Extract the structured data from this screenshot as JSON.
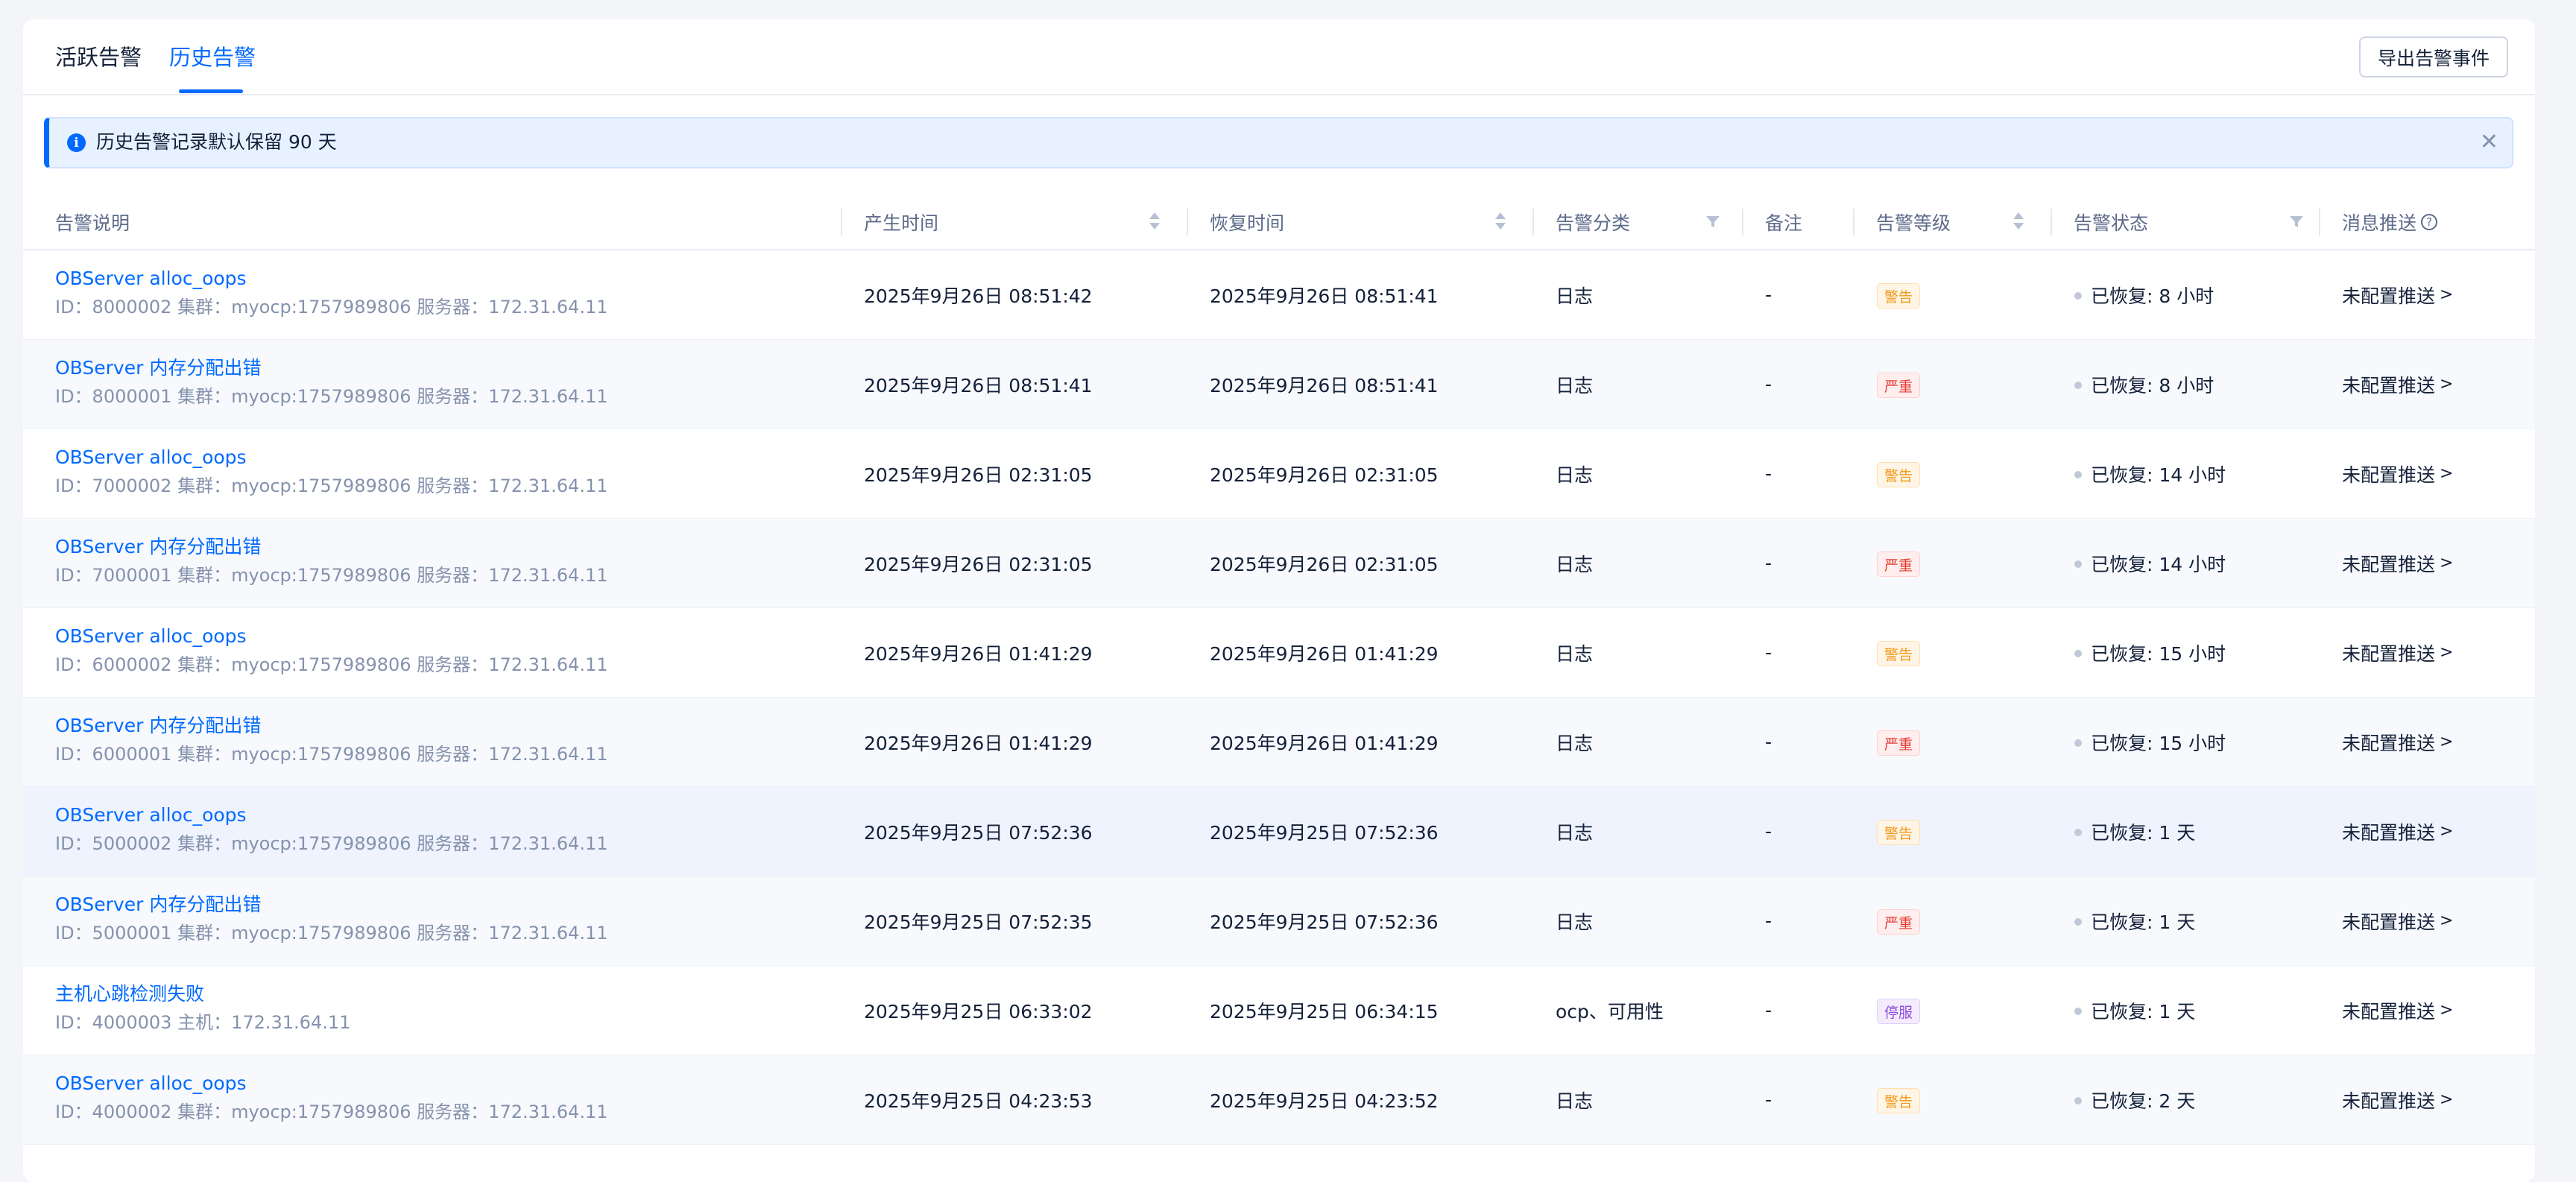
{
  "tabs": [
    {
      "label": "活跃告警",
      "active": false
    },
    {
      "label": "历史告警",
      "active": true
    }
  ],
  "toolbar": {
    "export_label": "导出告警事件"
  },
  "notice": {
    "text": "历史告警记录默认保留 90 天",
    "icon": "info-icon"
  },
  "columns": {
    "desc": "告警说明",
    "created": "产生时间",
    "recovered": "恢复时间",
    "category": "告警分类",
    "remark": "备注",
    "level": "告警等级",
    "status": "告警状态",
    "push": "消息推送"
  },
  "colors": {
    "accent": "#006aff",
    "warn": "#f09a1a",
    "critical": "#e63b33",
    "down": "#8c4de0"
  },
  "rows": [
    {
      "title": "OBServer alloc_oops",
      "meta": "ID：8000002  集群：myocp:1757989806  服务器：172.31.64.11",
      "created": "2025年9月26日 08:51:42",
      "recovered": "2025年9月26日 08:51:41",
      "category": "日志",
      "remark": "-",
      "level": "警告",
      "level_type": "warn",
      "status": "已恢复: 8 小时",
      "push": "未配置推送"
    },
    {
      "title": "OBServer 内存分配出错",
      "meta": "ID：8000001  集群：myocp:1757989806  服务器：172.31.64.11",
      "created": "2025年9月26日 08:51:41",
      "recovered": "2025年9月26日 08:51:41",
      "category": "日志",
      "remark": "-",
      "level": "严重",
      "level_type": "crit",
      "status": "已恢复: 8 小时",
      "push": "未配置推送"
    },
    {
      "title": "OBServer alloc_oops",
      "meta": "ID：7000002  集群：myocp:1757989806  服务器：172.31.64.11",
      "created": "2025年9月26日 02:31:05",
      "recovered": "2025年9月26日 02:31:05",
      "category": "日志",
      "remark": "-",
      "level": "警告",
      "level_type": "warn",
      "status": "已恢复: 14 小时",
      "push": "未配置推送"
    },
    {
      "title": "OBServer 内存分配出错",
      "meta": "ID：7000001  集群：myocp:1757989806  服务器：172.31.64.11",
      "created": "2025年9月26日 02:31:05",
      "recovered": "2025年9月26日 02:31:05",
      "category": "日志",
      "remark": "-",
      "level": "严重",
      "level_type": "crit",
      "status": "已恢复: 14 小时",
      "push": "未配置推送"
    },
    {
      "title": "OBServer alloc_oops",
      "meta": "ID：6000002  集群：myocp:1757989806  服务器：172.31.64.11",
      "created": "2025年9月26日 01:41:29",
      "recovered": "2025年9月26日 01:41:29",
      "category": "日志",
      "remark": "-",
      "level": "警告",
      "level_type": "warn",
      "status": "已恢复: 15 小时",
      "push": "未配置推送"
    },
    {
      "title": "OBServer 内存分配出错",
      "meta": "ID：6000001  集群：myocp:1757989806  服务器：172.31.64.11",
      "created": "2025年9月26日 01:41:29",
      "recovered": "2025年9月26日 01:41:29",
      "category": "日志",
      "remark": "-",
      "level": "严重",
      "level_type": "crit",
      "status": "已恢复: 15 小时",
      "push": "未配置推送"
    },
    {
      "title": "OBServer alloc_oops",
      "meta": "ID：5000002  集群：myocp:1757989806  服务器：172.31.64.11",
      "created": "2025年9月25日 07:52:36",
      "recovered": "2025年9月25日 07:52:36",
      "category": "日志",
      "remark": "-",
      "level": "警告",
      "level_type": "warn",
      "status": "已恢复: 1 天",
      "push": "未配置推送"
    },
    {
      "title": "OBServer 内存分配出错",
      "meta": "ID：5000001  集群：myocp:1757989806  服务器：172.31.64.11",
      "created": "2025年9月25日 07:52:35",
      "recovered": "2025年9月25日 07:52:36",
      "category": "日志",
      "remark": "-",
      "level": "严重",
      "level_type": "crit",
      "status": "已恢复: 1 天",
      "push": "未配置推送"
    },
    {
      "title": "主机心跳检测失败",
      "meta": "ID：4000003  主机：172.31.64.11",
      "created": "2025年9月25日 06:33:02",
      "recovered": "2025年9月25日 06:34:15",
      "category": "ocp、可用性",
      "remark": "-",
      "level": "停服",
      "level_type": "down",
      "status": "已恢复: 1 天",
      "push": "未配置推送"
    },
    {
      "title": "OBServer alloc_oops",
      "meta": "ID：4000002  集群：myocp:1757989806  服务器：172.31.64.11",
      "created": "2025年9月25日 04:23:53",
      "recovered": "2025年9月25日 04:23:52",
      "category": "日志",
      "remark": "-",
      "level": "警告",
      "level_type": "warn",
      "status": "已恢复: 2 天",
      "push": "未配置推送"
    }
  ]
}
